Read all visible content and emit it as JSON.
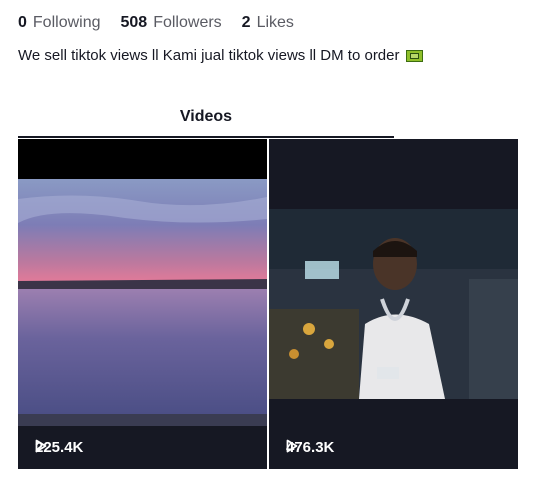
{
  "profile": {
    "stats": [
      {
        "value": "0",
        "label": "Following"
      },
      {
        "value": "508",
        "label": "Followers"
      },
      {
        "value": "2",
        "label": "Likes"
      }
    ],
    "bio": "We sell tiktok views ll Kami jual tiktok views ll DM to order",
    "bio_icon": "money-flag-icon"
  },
  "tabs": [
    {
      "label": "Videos",
      "active": true
    }
  ],
  "videos": [
    {
      "views": "225.4K",
      "icon": "play-icon"
    },
    {
      "views": "476.3K",
      "icon": "play-icon"
    }
  ],
  "colors": {
    "text": "#161823",
    "muted": "#5a5b63",
    "card_bg": "#161823"
  }
}
